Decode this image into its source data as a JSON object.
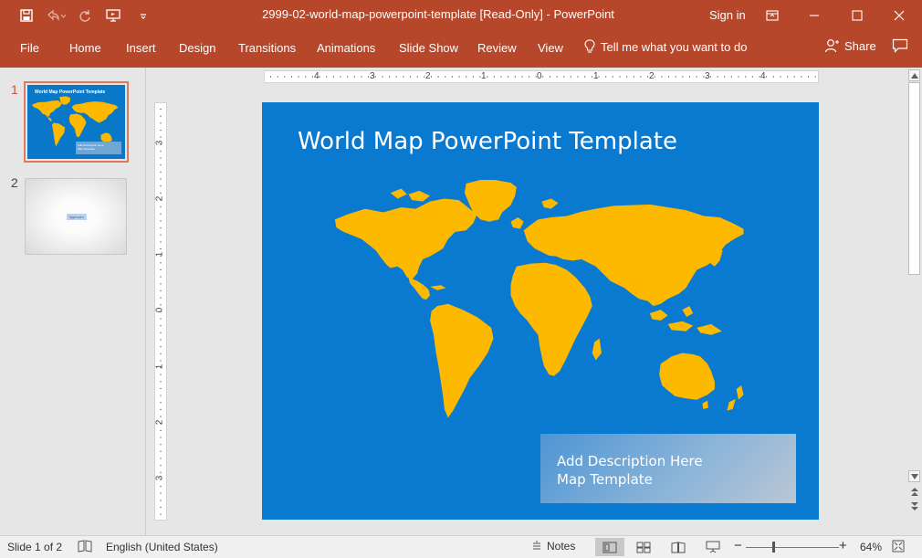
{
  "window": {
    "title": "2999-02-world-map-powerpoint-template [Read-Only] - PowerPoint",
    "sign_in": "Sign in"
  },
  "ribbon": {
    "tabs": [
      "File",
      "Home",
      "Insert",
      "Design",
      "Transitions",
      "Animations",
      "Slide Show",
      "Review",
      "View"
    ],
    "tell_me": "Tell me what you want to do",
    "share": "Share"
  },
  "thumbnails": {
    "slides": [
      {
        "number": "1",
        "title": "World Map PowerPoint Template",
        "desc_line1": "Add Description Here",
        "desc_line2": "Map Template"
      },
      {
        "number": "2",
        "label": "fppt.com"
      }
    ]
  },
  "ruler": {
    "horizontal": [
      "4",
      "3",
      "2",
      "1",
      "0",
      "1",
      "2",
      "3",
      "4"
    ],
    "vertical": [
      "3",
      "2",
      "1",
      "0",
      "1",
      "2",
      "3"
    ]
  },
  "slide": {
    "title": "World Map PowerPoint Template",
    "desc_line1": "Add Description Here",
    "desc_line2": "Map Template",
    "colors": {
      "background": "#0a7ad0",
      "map": "#fdb900"
    }
  },
  "status": {
    "slide_info": "Slide 1 of 2",
    "language": "English (United States)",
    "notes": "Notes",
    "zoom": "64%"
  },
  "colors": {
    "accent": "#b7472a"
  }
}
